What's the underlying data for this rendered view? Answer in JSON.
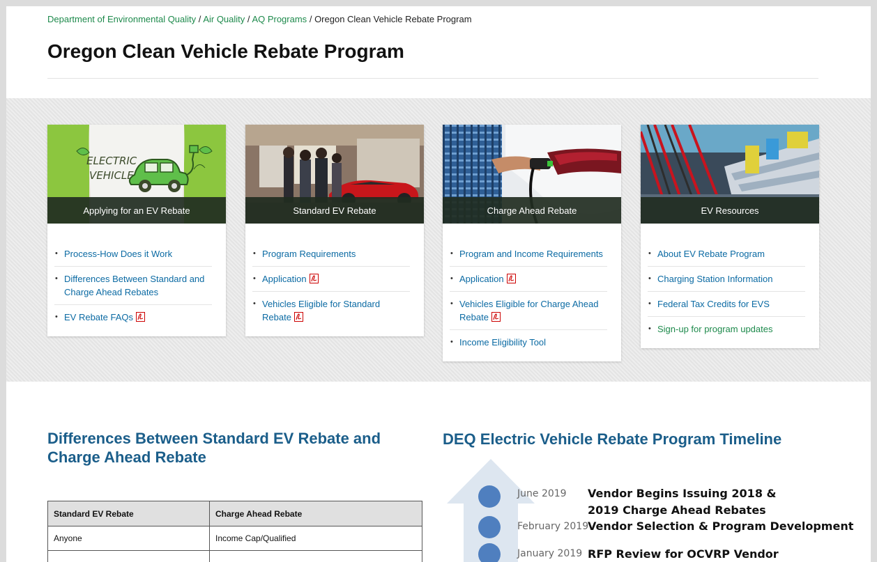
{
  "breadcrumb": {
    "items": [
      "Department of Environmental Quality",
      "Air Quality",
      "AQ Programs"
    ],
    "separator": "/",
    "current": "Oregon Clean Vehicle Rebate Program"
  },
  "page_title": "Oregon Clean Vehicle Rebate Program",
  "cards": [
    {
      "caption": "Applying for an EV Rebate",
      "image_text": [
        "ELECTRIC",
        "VEHICLE"
      ],
      "links": [
        {
          "label": "Process-How Does it Work",
          "pdf": false
        },
        {
          "label": "Differences Between Standard and Charge Ahead Rebates",
          "pdf": false
        },
        {
          "label": "EV Rebate FAQs",
          "pdf": true
        }
      ]
    },
    {
      "caption": "Standard EV Rebate",
      "links": [
        {
          "label": "Program Requirements",
          "pdf": false
        },
        {
          "label": "Application",
          "pdf": true
        },
        {
          "label": "Vehicles Eligible for Standard Rebate",
          "pdf": true
        }
      ]
    },
    {
      "caption": "Charge Ahead Rebate",
      "links": [
        {
          "label": "Program and Income Requirements",
          "pdf": false
        },
        {
          "label": "Application",
          "pdf": true
        },
        {
          "label": "Vehicles Eligible for Charge Ahead Rebate",
          "pdf": true
        },
        {
          "label": "Income Eligibility Tool",
          "pdf": false
        }
      ]
    },
    {
      "caption": "EV Resources",
      "links": [
        {
          "label": "About EV Rebate Program",
          "pdf": false
        },
        {
          "label": "Charging Station Information",
          "pdf": false
        },
        {
          "label": "Federal Tax Credits for EVS",
          "pdf": false
        },
        {
          "label": "Sign-up for program updates",
          "pdf": false
        }
      ]
    }
  ],
  "differences": {
    "title": "Differences Between Standard EV Rebate and Charge Ahead Rebate",
    "headers": [
      "Standard EV Rebate",
      "Charge Ahead Rebate"
    ],
    "rows": [
      [
        "Anyone",
        "Income Cap/Qualified"
      ],
      [
        "",
        ""
      ]
    ]
  },
  "timeline": {
    "title": "DEQ Electric Vehicle Rebate Program Timeline",
    "entries": [
      {
        "date": "June 2019",
        "text": "Vendor Begins Issuing 2018 & 2019 Charge Ahead Rebates"
      },
      {
        "date": "February 2019",
        "text": "Vendor Selection & Program Development"
      },
      {
        "date": "January 2019",
        "text": "RFP Review for OCVRP Vendor"
      }
    ]
  },
  "colors": {
    "link": "#0b6aa3",
    "breadcrumb_link": "#1e8a4c",
    "section_title": "#1b5e8a",
    "caption_bg": "#212d21",
    "timeline_dot": "#4f7fbf"
  },
  "icons": {
    "pdf": "pdf-icon"
  }
}
